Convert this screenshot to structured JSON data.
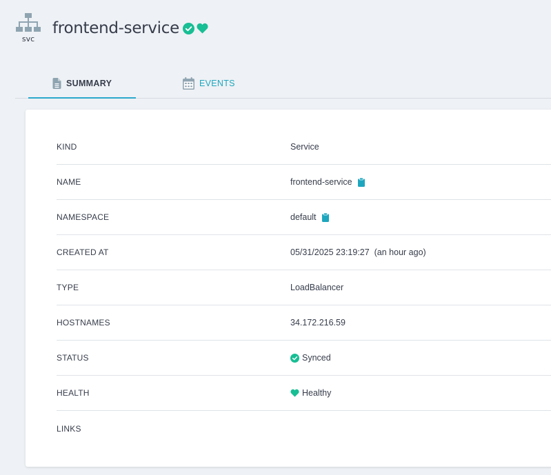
{
  "resource": {
    "kind_abbrev": "svc",
    "name": "frontend-service",
    "sync_icon": "check-circle-icon",
    "health_icon": "heart-icon"
  },
  "tabs": [
    {
      "label": "SUMMARY",
      "icon": "file-icon",
      "active": true
    },
    {
      "label": "EVENTS",
      "icon": "calendar-icon",
      "active": false
    }
  ],
  "summary": {
    "rows": [
      {
        "label": "KIND",
        "value": "Service"
      },
      {
        "label": "NAME",
        "value": "frontend-service",
        "copy_icon": "clipboard-icon"
      },
      {
        "label": "NAMESPACE",
        "value": "default",
        "copy_icon": "clipboard-icon"
      },
      {
        "label": "CREATED AT",
        "value": "05/31/2025 23:19:27  (an hour ago)"
      },
      {
        "label": "TYPE",
        "value": "LoadBalancer"
      },
      {
        "label": "HOSTNAMES",
        "value": "34.172.216.59"
      },
      {
        "label": "STATUS",
        "value": "Synced",
        "status_icon": "check-circle-icon"
      },
      {
        "label": "HEALTH",
        "value": "Healthy",
        "status_icon": "heart-icon"
      },
      {
        "label": "LINKS",
        "value": ""
      }
    ]
  },
  "colors": {
    "accent": "#1ea6be",
    "synced": "#18be94",
    "healthy": "#18be94",
    "icon_gray": "#8fa4b1"
  }
}
